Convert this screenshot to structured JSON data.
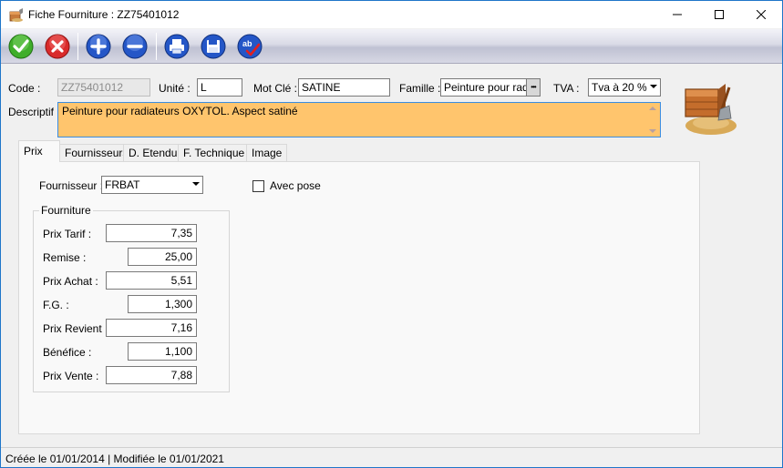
{
  "window": {
    "title": "Fiche Fourniture : ZZ75401012"
  },
  "toolbar": {
    "buttons": [
      "validate",
      "cancel",
      "add",
      "remove",
      "print",
      "save",
      "spellcheck"
    ]
  },
  "header": {
    "code_label": "Code :",
    "code_value": "ZZ75401012",
    "unite_label": "Unité :",
    "unite_value": "L",
    "motcle_label": "Mot Clé :",
    "motcle_value": "SATINE",
    "famille_label": "Famille :",
    "famille_value": "Peinture pour radia",
    "famille_button": "•••",
    "tva_label": "TVA :",
    "tva_value": "Tva à 20 %",
    "descriptif_label": "Descriptif :",
    "descriptif_value": "Peinture pour radiateurs OXYTOL. Aspect satiné"
  },
  "tabs": [
    {
      "label": "Prix",
      "active": true
    },
    {
      "label": "Fournisseurs",
      "active": false
    },
    {
      "label": "D. Etendu",
      "active": false
    },
    {
      "label": "F. Technique",
      "active": false
    },
    {
      "label": "Image",
      "active": false
    }
  ],
  "prix": {
    "fournisseur_label": "Fournisseur :",
    "fournisseur_value": "FRBAT",
    "avec_pose_label": "Avec pose",
    "avec_pose_checked": false,
    "group_title": "Fourniture",
    "rows": [
      {
        "label": "Prix Tarif :",
        "value": "7,35"
      },
      {
        "label": "Remise :",
        "value": "25,00"
      },
      {
        "label": "Prix Achat :",
        "value": "5,51"
      },
      {
        "label": "F.G. :",
        "value": "1,300"
      },
      {
        "label": "Prix Revient :",
        "value": "7,16"
      },
      {
        "label": "Bénéfice :",
        "value": "1,100"
      },
      {
        "label": "Prix Vente :",
        "value": "7,88"
      }
    ]
  },
  "status": {
    "text": "Créée le 01/01/2014 | Modifiée le 01/01/2021"
  },
  "colors": {
    "description_bg": "#ffc56d",
    "accent": "#3b8de0"
  }
}
